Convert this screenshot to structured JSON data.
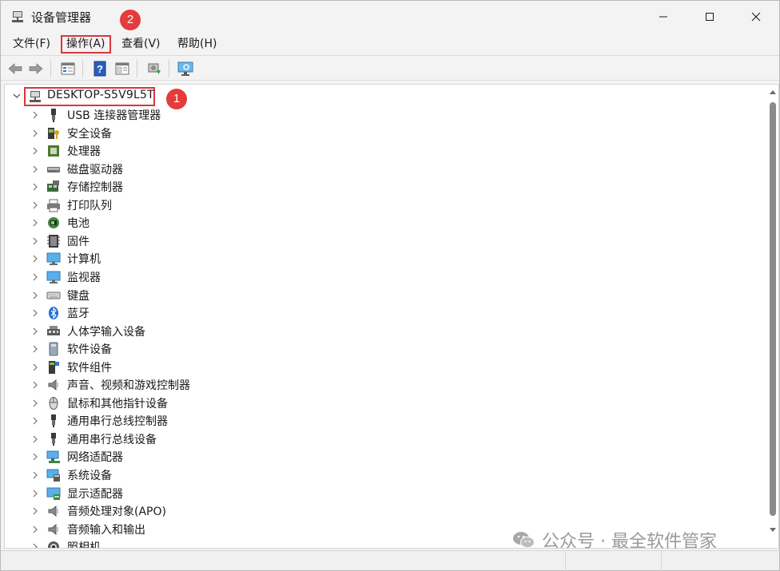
{
  "window": {
    "title": "设备管理器",
    "icon": "device-manager-icon"
  },
  "menu": {
    "file": "文件(F)",
    "action": "操作(A)",
    "view": "查看(V)",
    "help": "帮助(H)"
  },
  "toolbar": {
    "buttons": [
      "back-arrow-icon",
      "forward-arrow-icon",
      "properties-icon",
      "help-icon",
      "show-hide-icon",
      "scan-hardware-icon",
      "monitor-icon"
    ]
  },
  "tree": {
    "root": "DESKTOP-S5V9L5T",
    "items": [
      {
        "label": "USB 连接器管理器",
        "icon": "usb-connector-icon"
      },
      {
        "label": "安全设备",
        "icon": "security-device-icon"
      },
      {
        "label": "处理器",
        "icon": "processor-icon"
      },
      {
        "label": "磁盘驱动器",
        "icon": "disk-drive-icon"
      },
      {
        "label": "存储控制器",
        "icon": "storage-controller-icon"
      },
      {
        "label": "打印队列",
        "icon": "printer-icon"
      },
      {
        "label": "电池",
        "icon": "battery-icon"
      },
      {
        "label": "固件",
        "icon": "firmware-icon"
      },
      {
        "label": "计算机",
        "icon": "computer-icon"
      },
      {
        "label": "监视器",
        "icon": "monitor-icon"
      },
      {
        "label": "键盘",
        "icon": "keyboard-icon"
      },
      {
        "label": "蓝牙",
        "icon": "bluetooth-icon"
      },
      {
        "label": "人体学输入设备",
        "icon": "hid-icon"
      },
      {
        "label": "软件设备",
        "icon": "software-device-icon"
      },
      {
        "label": "软件组件",
        "icon": "software-component-icon"
      },
      {
        "label": "声音、视频和游戏控制器",
        "icon": "speaker-icon"
      },
      {
        "label": "鼠标和其他指针设备",
        "icon": "mouse-icon"
      },
      {
        "label": "通用串行总线控制器",
        "icon": "usb-controller-icon"
      },
      {
        "label": "通用串行总线设备",
        "icon": "usb-device-icon"
      },
      {
        "label": "网络适配器",
        "icon": "network-adapter-icon"
      },
      {
        "label": "系统设备",
        "icon": "system-device-icon"
      },
      {
        "label": "显示适配器",
        "icon": "display-adapter-icon"
      },
      {
        "label": "音频处理对象(APO)",
        "icon": "audio-apo-icon"
      },
      {
        "label": "音频输入和输出",
        "icon": "audio-io-icon"
      },
      {
        "label": "照相机",
        "icon": "camera-icon"
      }
    ]
  },
  "callouts": {
    "one": "1",
    "two": "2"
  },
  "watermark": "公众号 · 最全软件管家",
  "colors": {
    "highlight_border": "#d9363e",
    "callout_fill": "#e53b3b",
    "window_bg": "#f3f3f3"
  }
}
